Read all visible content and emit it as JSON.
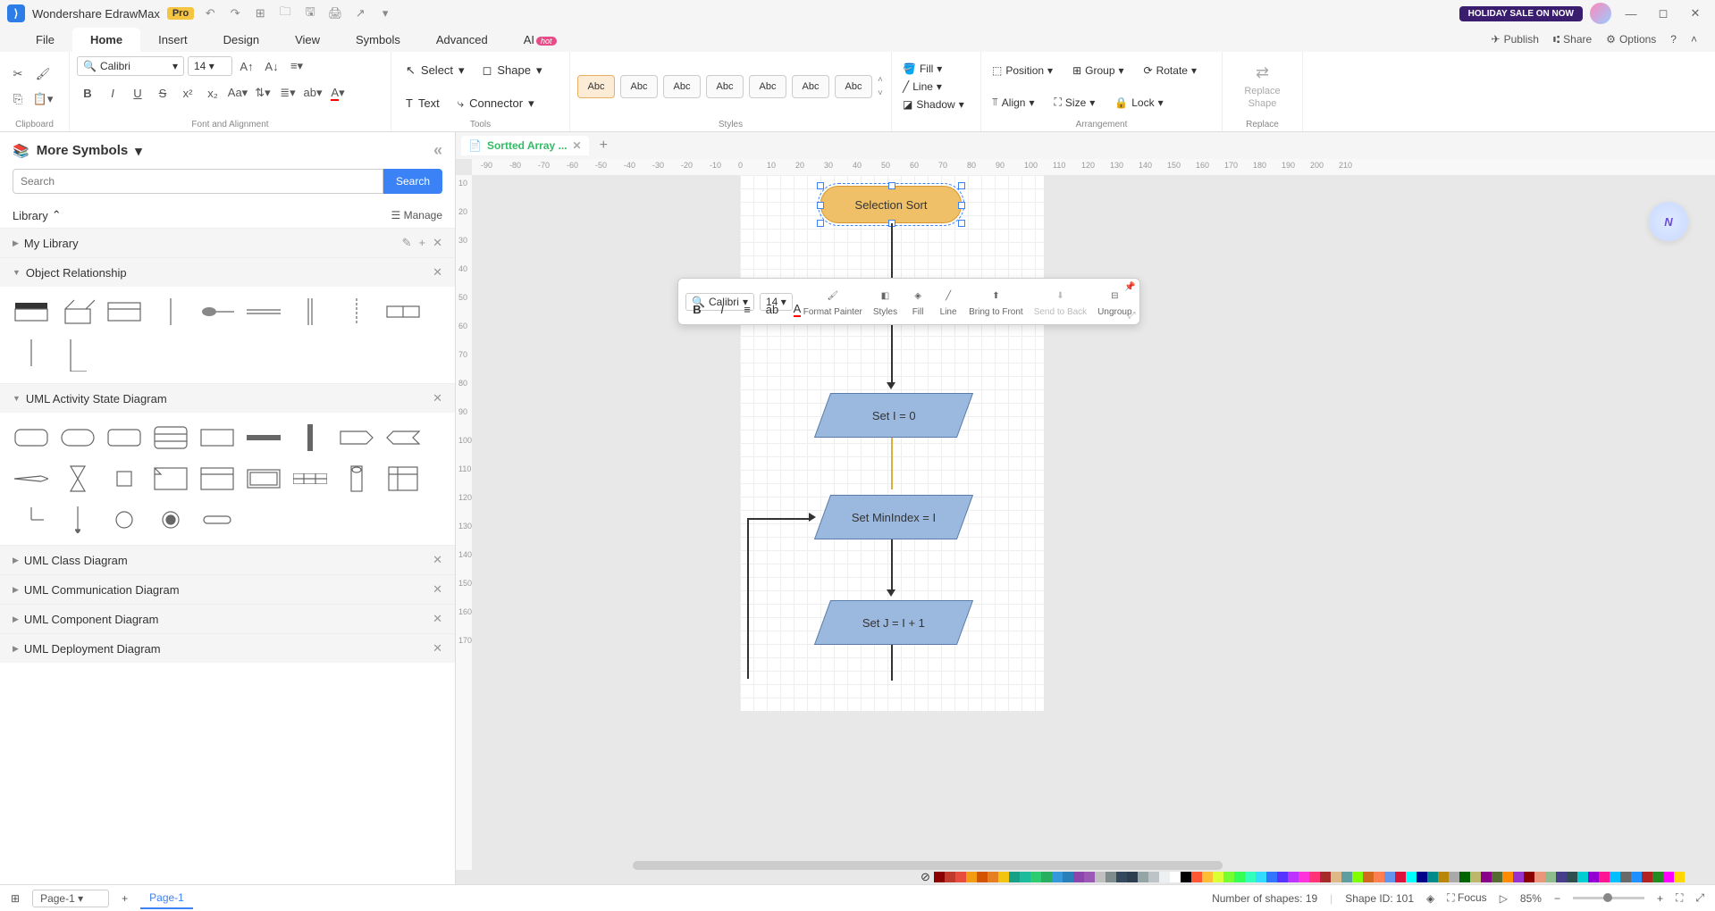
{
  "app": {
    "title": "Wondershare EdrawMax",
    "pro": "Pro",
    "holiday": "HOLIDAY SALE ON NOW"
  },
  "menu": {
    "file": "File",
    "home": "Home",
    "insert": "Insert",
    "design": "Design",
    "view": "View",
    "symbols": "Symbols",
    "advanced": "Advanced",
    "ai": "AI",
    "ai_hot": "hot",
    "publish": "Publish",
    "share": "Share",
    "options": "Options"
  },
  "ribbon": {
    "clipboard": "Clipboard",
    "font": "Calibri",
    "size": "14",
    "fontgroup": "Font and Alignment",
    "select": "Select",
    "text": "Text",
    "shape": "Shape",
    "connector": "Connector",
    "tools": "Tools",
    "abc": "Abc",
    "styles": "Styles",
    "fill": "Fill",
    "line": "Line",
    "shadow": "Shadow",
    "position": "Position",
    "align": "Align",
    "group": "Group",
    "sizebtn": "Size",
    "rotate": "Rotate",
    "lock": "Lock",
    "arrangement": "Arrangement",
    "replace_shape": "Replace Shape",
    "replace": "Replace"
  },
  "left": {
    "title": "More Symbols",
    "search_ph": "Search",
    "search_btn": "Search",
    "library": "Library",
    "manage": "Manage",
    "mylib": "My Library",
    "cats": {
      "obj_rel": "Object Relationship",
      "uml_activity": "UML Activity State Diagram",
      "uml_class": "UML Class Diagram",
      "uml_comm": "UML Communication Diagram",
      "uml_comp": "UML Component Diagram",
      "uml_deploy": "UML Deployment Diagram"
    }
  },
  "tabs": {
    "doc": "Sortted Array ..."
  },
  "canvas": {
    "n1": "Selection Sort",
    "n2": "Set I = 0",
    "n3": "Set MinIndex = I",
    "n4": "Set J = I + 1"
  },
  "float": {
    "font": "Calibri",
    "size": "14",
    "format_painter": "Format Painter",
    "styles": "Styles",
    "fill": "Fill",
    "line": "Line",
    "bring_front": "Bring to Front",
    "send_back": "Send to Back",
    "ungroup": "Ungroup"
  },
  "ruler_h": [
    "-90",
    "-80",
    "-70",
    "-60",
    "-50",
    "-40",
    "-30",
    "-20",
    "-10",
    "0",
    "10",
    "20",
    "30",
    "40",
    "50",
    "60",
    "70",
    "80",
    "90",
    "100",
    "110",
    "120",
    "130",
    "140",
    "150",
    "160",
    "170",
    "180",
    "190",
    "200",
    "210"
  ],
  "ruler_v": [
    "10",
    "20",
    "30",
    "40",
    "50",
    "60",
    "70",
    "80",
    "90",
    "100",
    "110",
    "120",
    "130",
    "140",
    "150",
    "160",
    "170"
  ],
  "status": {
    "page_sel": "Page-1",
    "page_tab": "Page-1",
    "shapes": "Number of shapes: 19",
    "shape_id": "Shape ID: 101",
    "focus": "Focus",
    "zoom": "85%"
  },
  "colors": [
    "#8b0000",
    "#c0392b",
    "#e74c3c",
    "#f39c12",
    "#d35400",
    "#e67e22",
    "#f1c40f",
    "#16a085",
    "#1abc9c",
    "#2ecc71",
    "#27ae60",
    "#3498db",
    "#2980b9",
    "#8e44ad",
    "#9b59b6",
    "#c0c0c0",
    "#7f8c8d",
    "#34495e",
    "#2c3e50",
    "#95a5a6",
    "#bdc3c7",
    "#ecf0f1",
    "#ffffff",
    "#000000",
    "#ff5733",
    "#ffbd33",
    "#dbff33",
    "#75ff33",
    "#33ff57",
    "#33ffbd",
    "#33dbff",
    "#3375ff",
    "#5733ff",
    "#bd33ff",
    "#ff33db",
    "#ff3375",
    "#a52a2a",
    "#deb887",
    "#5f9ea0",
    "#7fff00",
    "#d2691e",
    "#ff7f50",
    "#6495ed",
    "#dc143c",
    "#00ffff",
    "#00008b",
    "#008b8b",
    "#b8860b",
    "#a9a9a9",
    "#006400",
    "#bdb76b",
    "#8b008b",
    "#556b2f",
    "#ff8c00",
    "#9932cc",
    "#8b0000",
    "#e9967a",
    "#8fbc8f",
    "#483d8b",
    "#2f4f4f",
    "#00ced1",
    "#9400d3",
    "#ff1493",
    "#00bfff",
    "#696969",
    "#1e90ff",
    "#b22222",
    "#228b22",
    "#ff00ff",
    "#ffd700"
  ]
}
